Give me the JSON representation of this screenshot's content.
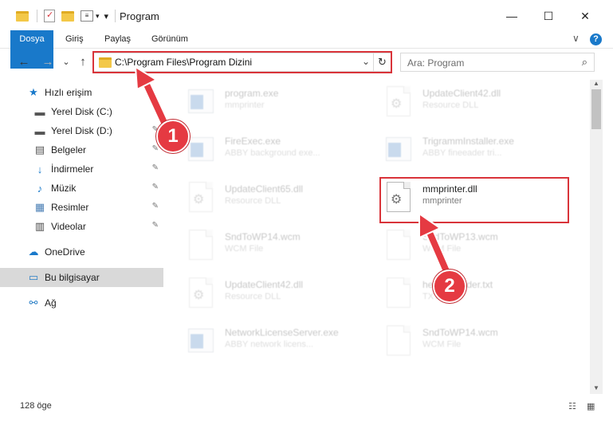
{
  "window": {
    "title": "Program",
    "minimize": "—",
    "maximize": "☐",
    "close": "✕"
  },
  "ribbon": {
    "tabs": [
      "Dosya",
      "Giriş",
      "Paylaş",
      "Görünüm"
    ],
    "collapse": "∨",
    "help": "?"
  },
  "address": {
    "path": "C:\\Program Files\\Program Dizini",
    "chevron": "⌄",
    "refresh": "↻"
  },
  "search": {
    "placeholder": "Ara: Program",
    "icon": "⌕"
  },
  "nav": {
    "back": "←",
    "forward": "→",
    "recent": "⌄",
    "up": "↑",
    "items": [
      {
        "label": "Hızlı erişim",
        "icon": "★"
      },
      {
        "label": "Yerel Disk (C:)",
        "icon": "▬"
      },
      {
        "label": "Yerel Disk (D:)",
        "icon": "▬"
      },
      {
        "label": "Belgeler",
        "icon": "▤"
      },
      {
        "label": "İndirmeler",
        "icon": "↓"
      },
      {
        "label": "Müzik",
        "icon": "♪"
      },
      {
        "label": "Resimler",
        "icon": "▦"
      },
      {
        "label": "Videolar",
        "icon": "▥"
      },
      {
        "label": "OneDrive",
        "icon": "☁"
      },
      {
        "label": "Bu bilgisayar",
        "icon": "▭"
      },
      {
        "label": "Ağ",
        "icon": "⚯"
      }
    ],
    "pin": "📌"
  },
  "files": [
    {
      "name": "program.exe",
      "desc": "mmprinter"
    },
    {
      "name": "UpdateClient42.dll",
      "desc": "Resource DLL"
    },
    {
      "name": "FireExec.exe",
      "desc": "ABBY background exe..."
    },
    {
      "name": "TrigrammInstaller.exe",
      "desc": "ABBY fineeader tri..."
    },
    {
      "name": "UpdateClient65.dll",
      "desc": "Resource DLL"
    },
    {
      "name": "mmprinter.dll",
      "desc": "mmprinter"
    },
    {
      "name": "SndToWP14.wcm",
      "desc": "WCM File"
    },
    {
      "name": "SndToWP13.wcm",
      "desc": "WCM File"
    },
    {
      "name": "UpdateClient42.dll",
      "desc": "Resource DLL"
    },
    {
      "name": "helpfilereader.txt",
      "desc": "TXT"
    },
    {
      "name": "NetworkLicenseServer.exe",
      "desc": "ABBY network licens..."
    },
    {
      "name": "SndToWP14.wcm",
      "desc": "WCM File"
    }
  ],
  "status": {
    "count": "128 öge"
  },
  "annotations": {
    "step1": "1",
    "step2": "2",
    "color": "#e53a42"
  }
}
